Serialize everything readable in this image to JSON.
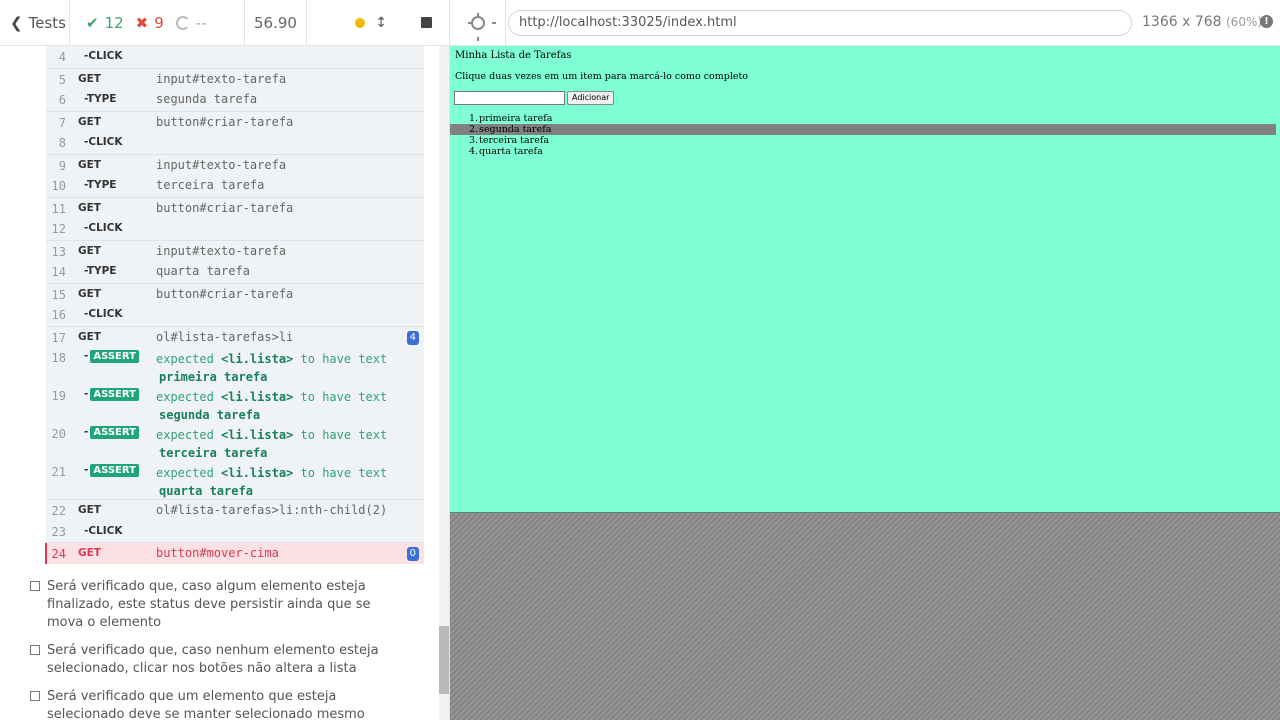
{
  "reporter": {
    "tests_label": "Tests",
    "passed": "12",
    "failed": "9",
    "pending": "--",
    "duration": "56.90"
  },
  "commands": [
    {
      "num": "4",
      "name": "-CLICK",
      "msg": ""
    },
    {
      "num": "5",
      "name": "GET",
      "msg": "input#texto-tarefa"
    },
    {
      "num": "6",
      "name": "-TYPE",
      "msg": "segunda tarefa"
    },
    {
      "num": "7",
      "name": "GET",
      "msg": "button#criar-tarefa"
    },
    {
      "num": "8",
      "name": "-CLICK",
      "msg": ""
    },
    {
      "num": "9",
      "name": "GET",
      "msg": "input#texto-tarefa"
    },
    {
      "num": "10",
      "name": "-TYPE",
      "msg": "terceira tarefa"
    },
    {
      "num": "11",
      "name": "GET",
      "msg": "button#criar-tarefa"
    },
    {
      "num": "12",
      "name": "-CLICK",
      "msg": ""
    },
    {
      "num": "13",
      "name": "GET",
      "msg": "input#texto-tarefa"
    },
    {
      "num": "14",
      "name": "-TYPE",
      "msg": "quarta tarefa"
    },
    {
      "num": "15",
      "name": "GET",
      "msg": "button#criar-tarefa"
    },
    {
      "num": "16",
      "name": "-CLICK",
      "msg": ""
    },
    {
      "num": "17",
      "name": "GET",
      "msg": "ol#lista-tarefas>li",
      "badge": "4"
    },
    {
      "num": "18",
      "name": "ASSERT",
      "expected": "expected",
      "subject": "<li.lista>",
      "verb": "to have text",
      "value": "primeira tarefa"
    },
    {
      "num": "19",
      "name": "ASSERT",
      "expected": "expected",
      "subject": "<li.lista>",
      "verb": "to have text",
      "value": "segunda tarefa"
    },
    {
      "num": "20",
      "name": "ASSERT",
      "expected": "expected",
      "subject": "<li.lista>",
      "verb": "to have text",
      "value": "terceira tarefa"
    },
    {
      "num": "21",
      "name": "ASSERT",
      "expected": "expected",
      "subject": "<li.lista>",
      "verb": "to have text",
      "value": "quarta tarefa"
    },
    {
      "num": "22",
      "name": "GET",
      "msg": "ol#lista-tarefas>li:nth-child(2)"
    },
    {
      "num": "23",
      "name": "-CLICK",
      "msg": ""
    },
    {
      "num": "24",
      "name": "GET",
      "msg": "button#mover-cima",
      "badge": "0"
    }
  ],
  "requirements": [
    "Será verificado que, caso algum elemento esteja finalizado, este status deve persistir ainda que se mova o elemento",
    "Será verificado que, caso nenhum elemento esteja selecionado, clicar nos botões não altera a lista",
    "Será verificado que um elemento que esteja selecionado deve se manter selecionado mesmo depois de movido"
  ],
  "runner": {
    "url": "http://localhost:33025/index.html",
    "viewport": "1366 x 768",
    "scale": "(60%)"
  },
  "app": {
    "title": "Minha Lista de Tarefas",
    "instructions": "Clique duas vezes em um item para marcá-lo como completo",
    "add_label": "Adicionar",
    "items": [
      {
        "n": "1.",
        "text": "primeira tarefa",
        "selected": false
      },
      {
        "n": "2.",
        "text": "segunda tarefa",
        "selected": true
      },
      {
        "n": "3.",
        "text": "terceira tarefa",
        "selected": false
      },
      {
        "n": "4.",
        "text": "quarta tarefa",
        "selected": false
      }
    ]
  },
  "colors": {
    "app_background": "#7fffd4",
    "selected_item": "#808080",
    "pass": "#3fa66a",
    "fail": "#e04a3f",
    "assert_tag": "#1ea67a",
    "failed_command": "#fbe0e4"
  }
}
